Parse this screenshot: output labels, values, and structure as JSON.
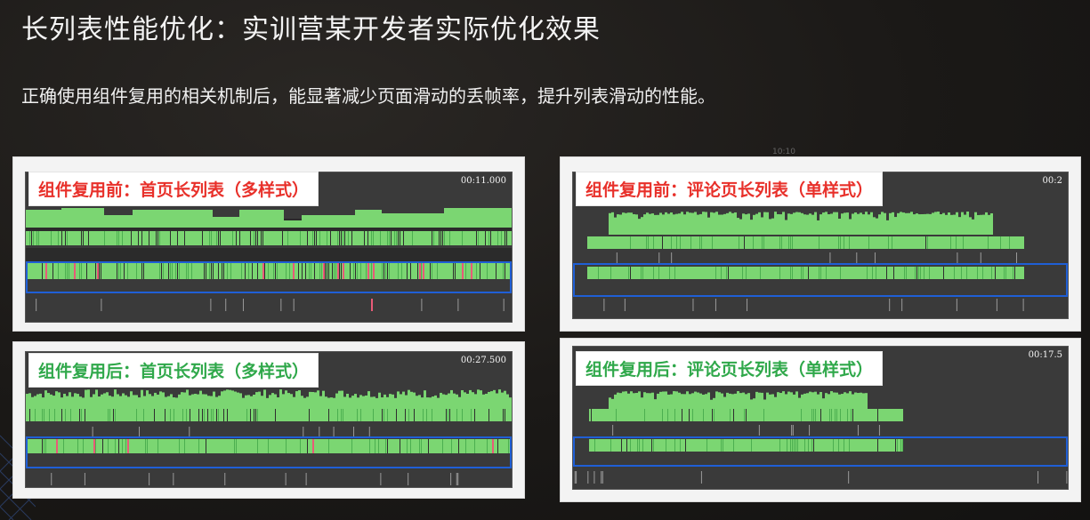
{
  "slide": {
    "title": "长列表性能优化：实训营某开发者实际优化效果",
    "subtitle": "正确使用组件复用的相关机制后，能显著减少页面滑动的丢帧率，提升列表滑动的性能。",
    "watermark": "10:10"
  },
  "panels": [
    {
      "id": "tl",
      "label": "组件复用前：首页长列表（多样式）",
      "variant": "before",
      "time": "00:11.000",
      "pattern": "dense-before"
    },
    {
      "id": "bl",
      "label": "组件复用后：首页长列表（多样式）",
      "variant": "after",
      "time": "00:27.500",
      "pattern": "dense-after"
    },
    {
      "id": "tr",
      "label": "组件复用前：评论页长列表（单样式）",
      "variant": "before",
      "time": "00:2",
      "pattern": "single-before"
    },
    {
      "id": "br",
      "label": "组件复用后：评论页长列表（单样式）",
      "variant": "after",
      "time": "00:17.5",
      "pattern": "single-after"
    }
  ],
  "colors": {
    "green": "#7bd672",
    "green_dark": "#4caf50",
    "red_frame": "#e85b78",
    "track_bg": "#3a3a3a",
    "highlight_blue": "#1f5fd6"
  }
}
